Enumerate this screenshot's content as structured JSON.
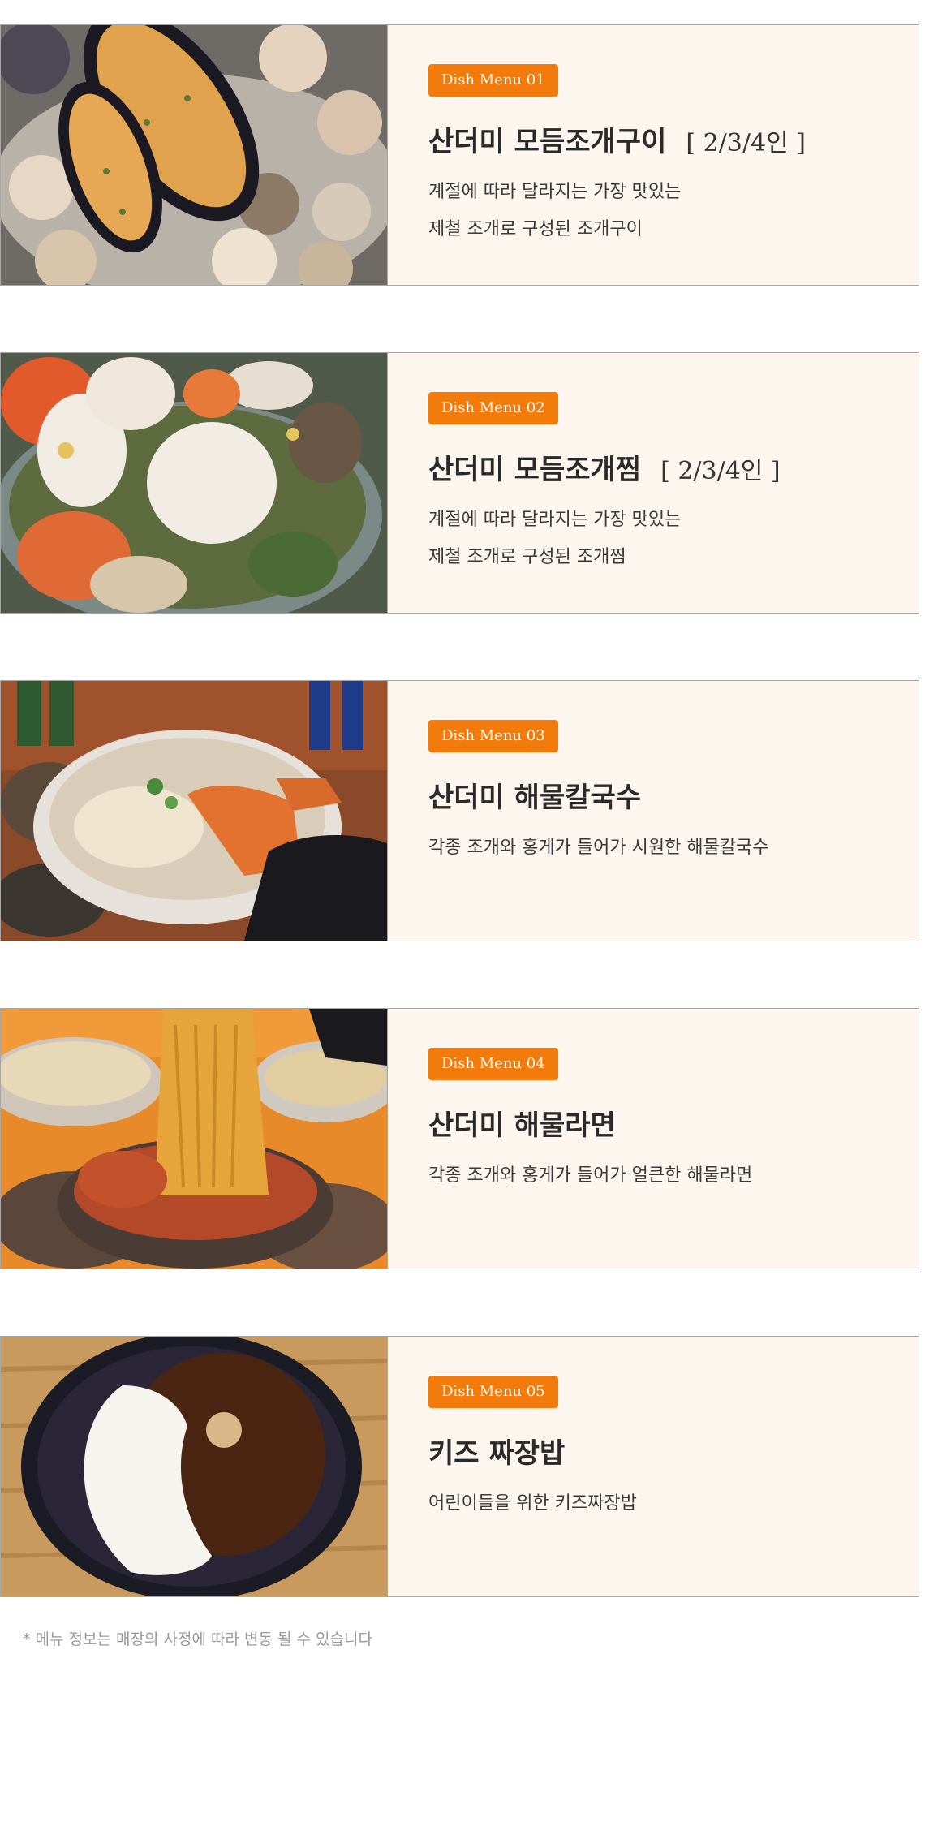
{
  "menu": [
    {
      "badge": "Dish Menu 01",
      "title": "산더미 모듬조개구이",
      "serving": "[ 2/3/4인 ]",
      "description": [
        "계절에 따라 달라지는 가장 맛있는",
        "제철 조개로 구성된 조개구이"
      ],
      "photo": "grilled-shellfish-platter"
    },
    {
      "badge": "Dish Menu 02",
      "title": "산더미 모듬조개찜",
      "serving": "[ 2/3/4인 ]",
      "description": [
        "계절에 따라 달라지는 가장 맛있는",
        "제철 조개로 구성된 조개찜"
      ],
      "photo": "steamed-shellfish-pot"
    },
    {
      "badge": "Dish Menu 03",
      "title": "산더미 해물칼국수",
      "serving": "",
      "description": [
        "각종 조개와 홍게가 들어가 시원한 해물칼국수"
      ],
      "photo": "seafood-noodle-soup"
    },
    {
      "badge": "Dish Menu 04",
      "title": "산더미 해물라면",
      "serving": "",
      "description": [
        "각종 조개와 홍게가 들어가 얼큰한 해물라면"
      ],
      "photo": "seafood-ramen"
    },
    {
      "badge": "Dish Menu 05",
      "title": "키즈 짜장밥",
      "serving": "",
      "description": [
        "어린이들을 위한 키즈짜장밥"
      ],
      "photo": "kids-jjajang-rice"
    }
  ],
  "notice": "* 메뉴 정보는 매장의 사정에 따라 변동 될 수 있습니다",
  "colors": {
    "badge": "#f37b0c",
    "card_background": "#fdf6ef",
    "card_border": "#a7a7a7",
    "title_text": "#2a2a2a",
    "notice_text": "#9a9a9a"
  }
}
